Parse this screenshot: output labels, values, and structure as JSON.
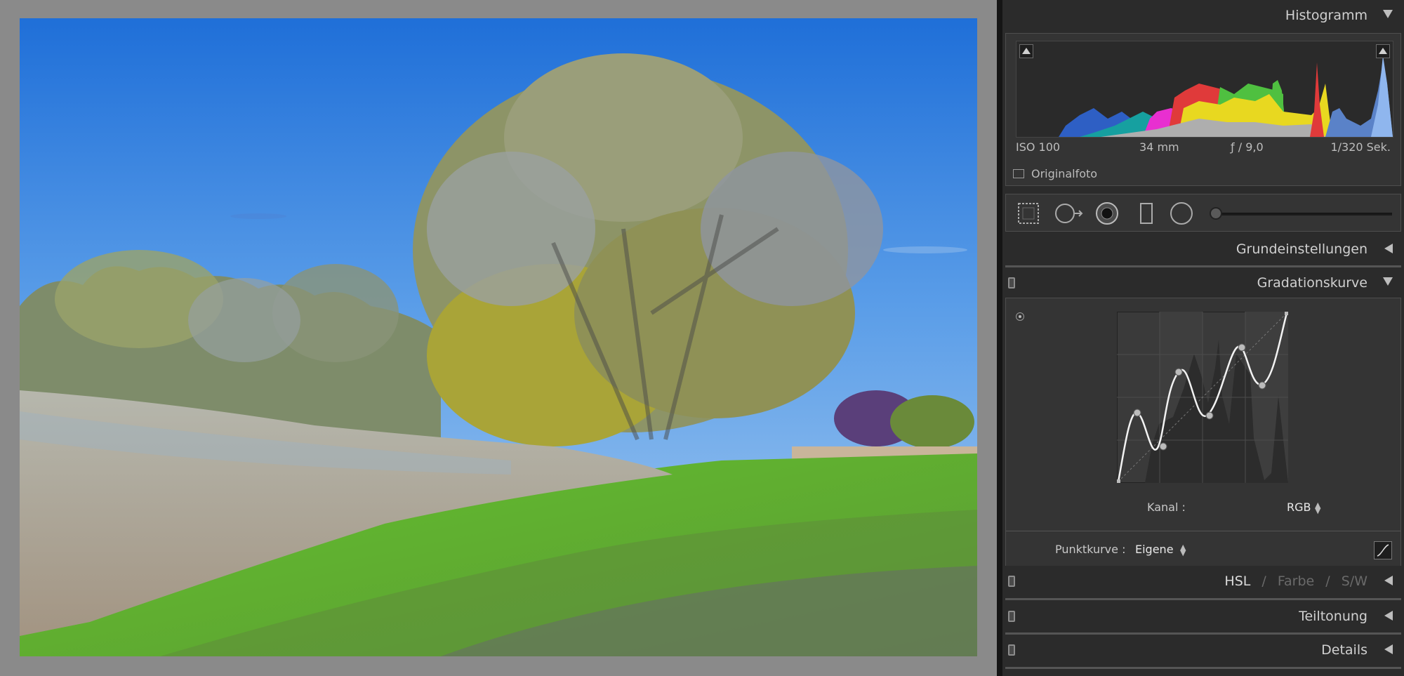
{
  "photo": {
    "description_icon": "landscape-photo"
  },
  "panel": {
    "histogram": {
      "title": "Histogramm",
      "iso": "ISO 100",
      "focal": "34 mm",
      "aperture": "ƒ / 9,0",
      "shutter": "1/320 Sek.",
      "original_label": "Originalfoto"
    },
    "basic": {
      "title": "Grundeinstellungen"
    },
    "tone_curve": {
      "title": "Gradationskurve",
      "channel_label": "Kanal :",
      "channel_value": "RGB",
      "pointcurve_label": "Punktkurve :",
      "pointcurve_value": "Eigene",
      "points": [
        [
          0,
          0
        ],
        [
          0.11,
          0.41
        ],
        [
          0.27,
          0.21
        ],
        [
          0.36,
          0.65
        ],
        [
          0.54,
          0.39
        ],
        [
          0.73,
          0.79
        ],
        [
          0.85,
          0.57
        ],
        [
          1,
          1
        ]
      ]
    },
    "hsl": {
      "hsl": "HSL",
      "sep": "/",
      "farbe": "Farbe",
      "sw": "S/W"
    },
    "split": {
      "title": "Teiltonung"
    },
    "details": {
      "title": "Details"
    }
  }
}
